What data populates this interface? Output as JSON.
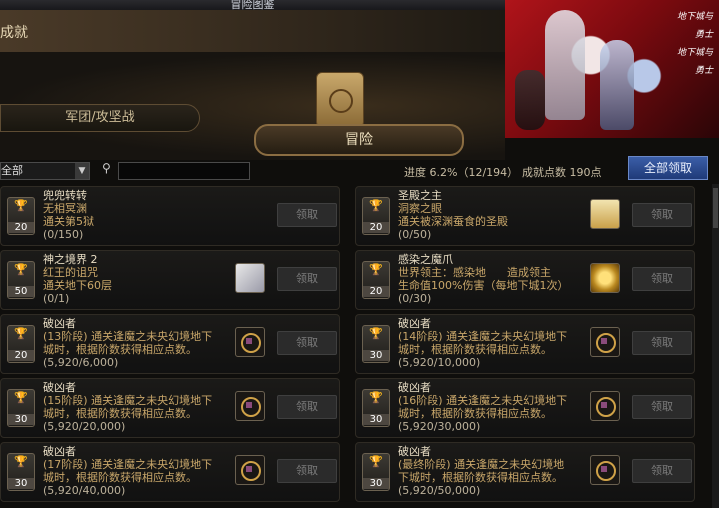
{
  "window": {
    "title": "冒险图鉴"
  },
  "header": {
    "title": "成就"
  },
  "tabs": {
    "guild_siege": "军团/攻坚战",
    "adventure": "冒险"
  },
  "filter": {
    "selected": "全部",
    "search_placeholder": ""
  },
  "stats": {
    "progress": "进度  6.2%（12/194）",
    "points": "成就点数 190点"
  },
  "buttons": {
    "claim_all": "全部领取"
  },
  "icons": {
    "dropdown": "chevron-down-icon",
    "search": "search-icon",
    "trophy": "trophy-icon",
    "scroll": "scroll-icon"
  },
  "colors": {
    "accent_gold": "#c9a76a",
    "claim_all_blue": "#2b4a8f"
  },
  "achievements": [
    {
      "name": "兜兜转转",
      "desc": "无相冥渊\n通关第5狱",
      "progress": "(0/150)",
      "points": "20",
      "claim": "领取",
      "reward": "none"
    },
    {
      "name": "圣殿之主",
      "desc": "洞察之眼\n通关被深渊蚕食的圣殿",
      "progress": "(0/50)",
      "points": "20",
      "claim": "领取",
      "reward": "map"
    },
    {
      "name": "神之境界 2",
      "desc": "红王的诅咒\n通关地下60层",
      "progress": "(0/1)",
      "points": "50",
      "claim": "领取",
      "reward": "scroll",
      "gold": true
    },
    {
      "name": "感染之魔爪",
      "desc": "世界领主：感染地      造成领主\n生命值100%伤害（每地下城1次）",
      "progress": "(0/30)",
      "points": "20",
      "claim": "领取",
      "reward": "star"
    },
    {
      "name": "破凶者",
      "desc": "(13阶段) 通关逢魔之未央幻境地下\n城时，根据阶数获得相应点数。",
      "progress": "(5,920/6,000)",
      "points": "20",
      "claim": "领取",
      "reward": "emblem"
    },
    {
      "name": "破凶者",
      "desc": "(14阶段) 通关逢魔之未央幻境地下\n城时，根据阶数获得相应点数。",
      "progress": "(5,920/10,000)",
      "points": "30",
      "claim": "领取",
      "reward": "emblem"
    },
    {
      "name": "破凶者",
      "desc": "(15阶段) 通关逢魔之未央幻境地下\n城时，根据阶数获得相应点数。",
      "progress": "(5,920/20,000)",
      "points": "30",
      "claim": "领取",
      "reward": "emblem"
    },
    {
      "name": "破凶者",
      "desc": "(16阶段) 通关逢魔之未央幻境地下\n城时，根据阶数获得相应点数。",
      "progress": "(5,920/30,000)",
      "points": "30",
      "claim": "领取",
      "reward": "emblem"
    },
    {
      "name": "破凶者",
      "desc": "(17阶段) 通关逢魔之未央幻境地下\n城时，根据阶数获得相应点数。",
      "progress": "(5,920/40,000)",
      "points": "30",
      "claim": "领取",
      "reward": "emblem"
    },
    {
      "name": "破凶者",
      "desc": "(最终阶段) 通关逢魔之未央幻境地\n下城时，根据阶数获得相应点数。",
      "progress": "(5,920/50,000)",
      "points": "30",
      "claim": "领取",
      "reward": "emblem"
    }
  ]
}
